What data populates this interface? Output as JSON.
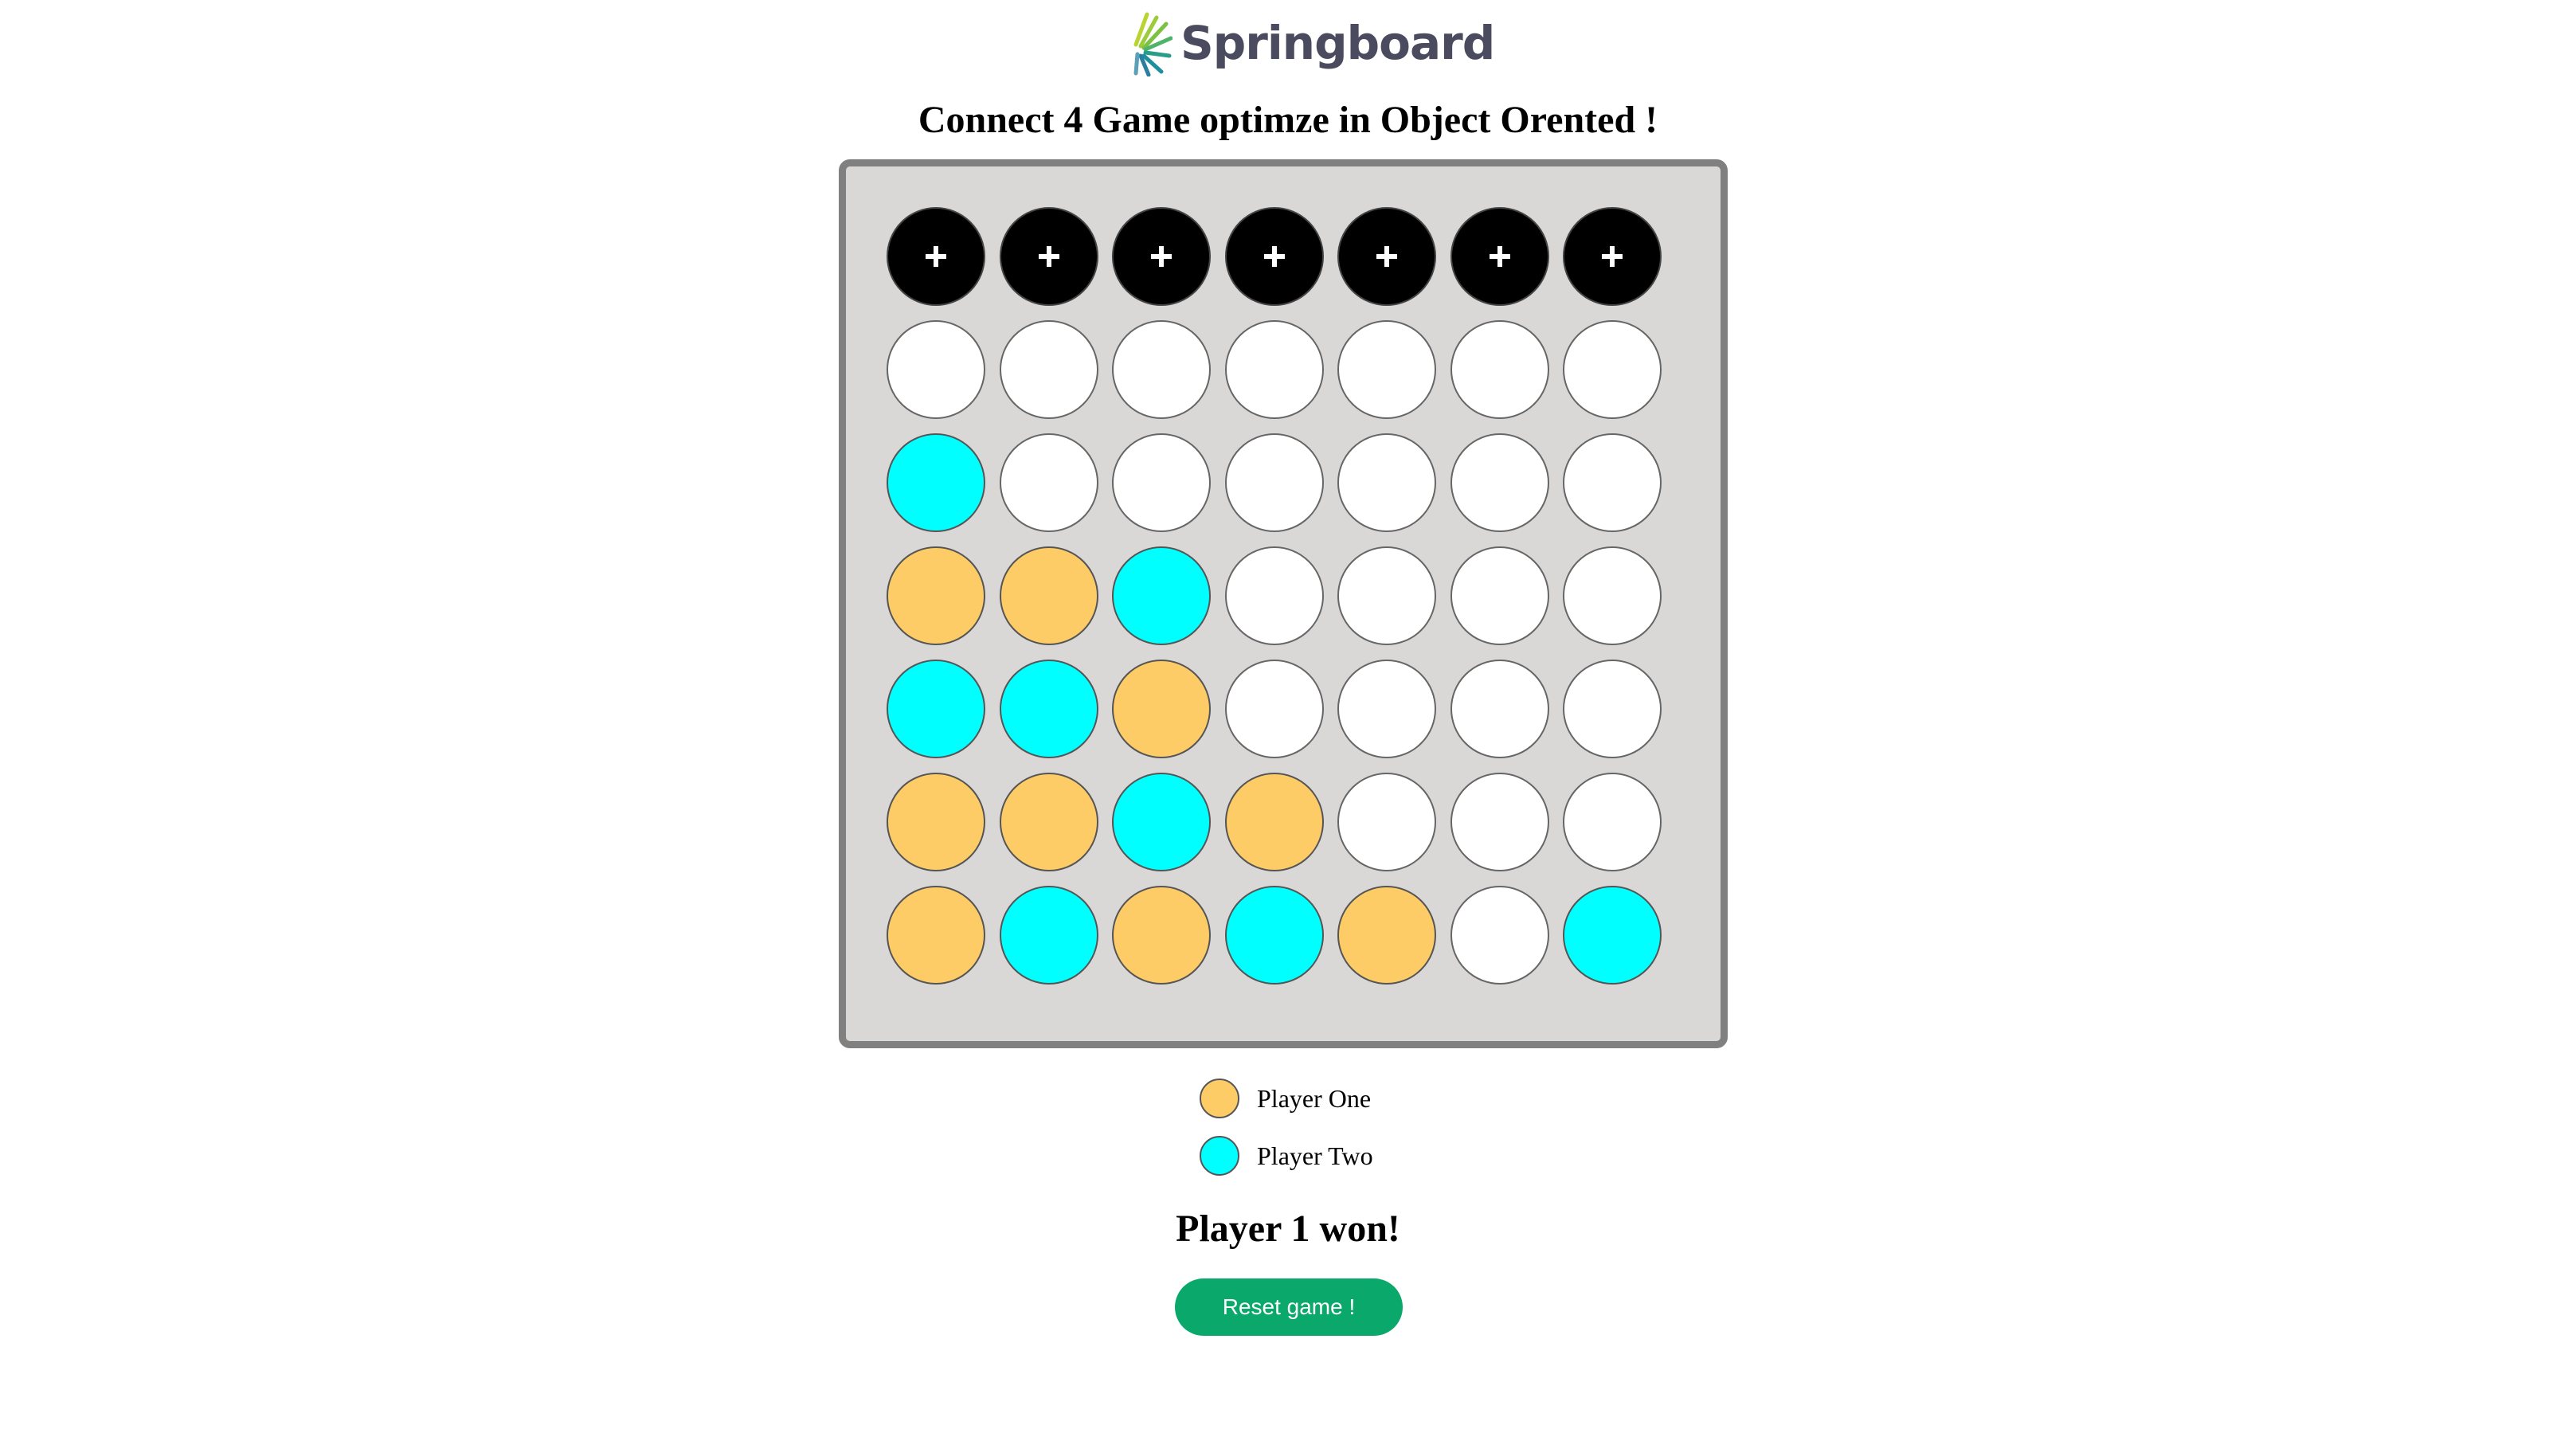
{
  "logo": {
    "text": "Springboard",
    "icon": "springboard-leaf-icon",
    "text_color": "#4a4b5e"
  },
  "title": "Connect 4 Game optimze in Object Orented !",
  "board": {
    "columns": 7,
    "rows": 6,
    "drop_icon": "plus-icon",
    "cells": [
      [
        "",
        "",
        "",
        "",
        "",
        "",
        ""
      ],
      [
        "2",
        "",
        "",
        "",
        "",
        "",
        ""
      ],
      [
        "1",
        "1",
        "2",
        "",
        "",
        "",
        ""
      ],
      [
        "2",
        "2",
        "1",
        "",
        "",
        "",
        ""
      ],
      [
        "1",
        "1",
        "2",
        "1",
        "",
        "",
        ""
      ],
      [
        "1",
        "2",
        "1",
        "2",
        "1",
        "",
        "2"
      ]
    ],
    "colors": {
      "player_one": "#fdcc66",
      "player_two": "#00ffff",
      "empty": "#ffffff",
      "board": "#dad7d7",
      "frame": "#808080",
      "drop_button": "#000000"
    }
  },
  "legend": {
    "player_one": "Player One",
    "player_two": "Player Two"
  },
  "status": "Player 1 won!",
  "reset_label": "Reset game !",
  "reset_color": "#0aa86a"
}
